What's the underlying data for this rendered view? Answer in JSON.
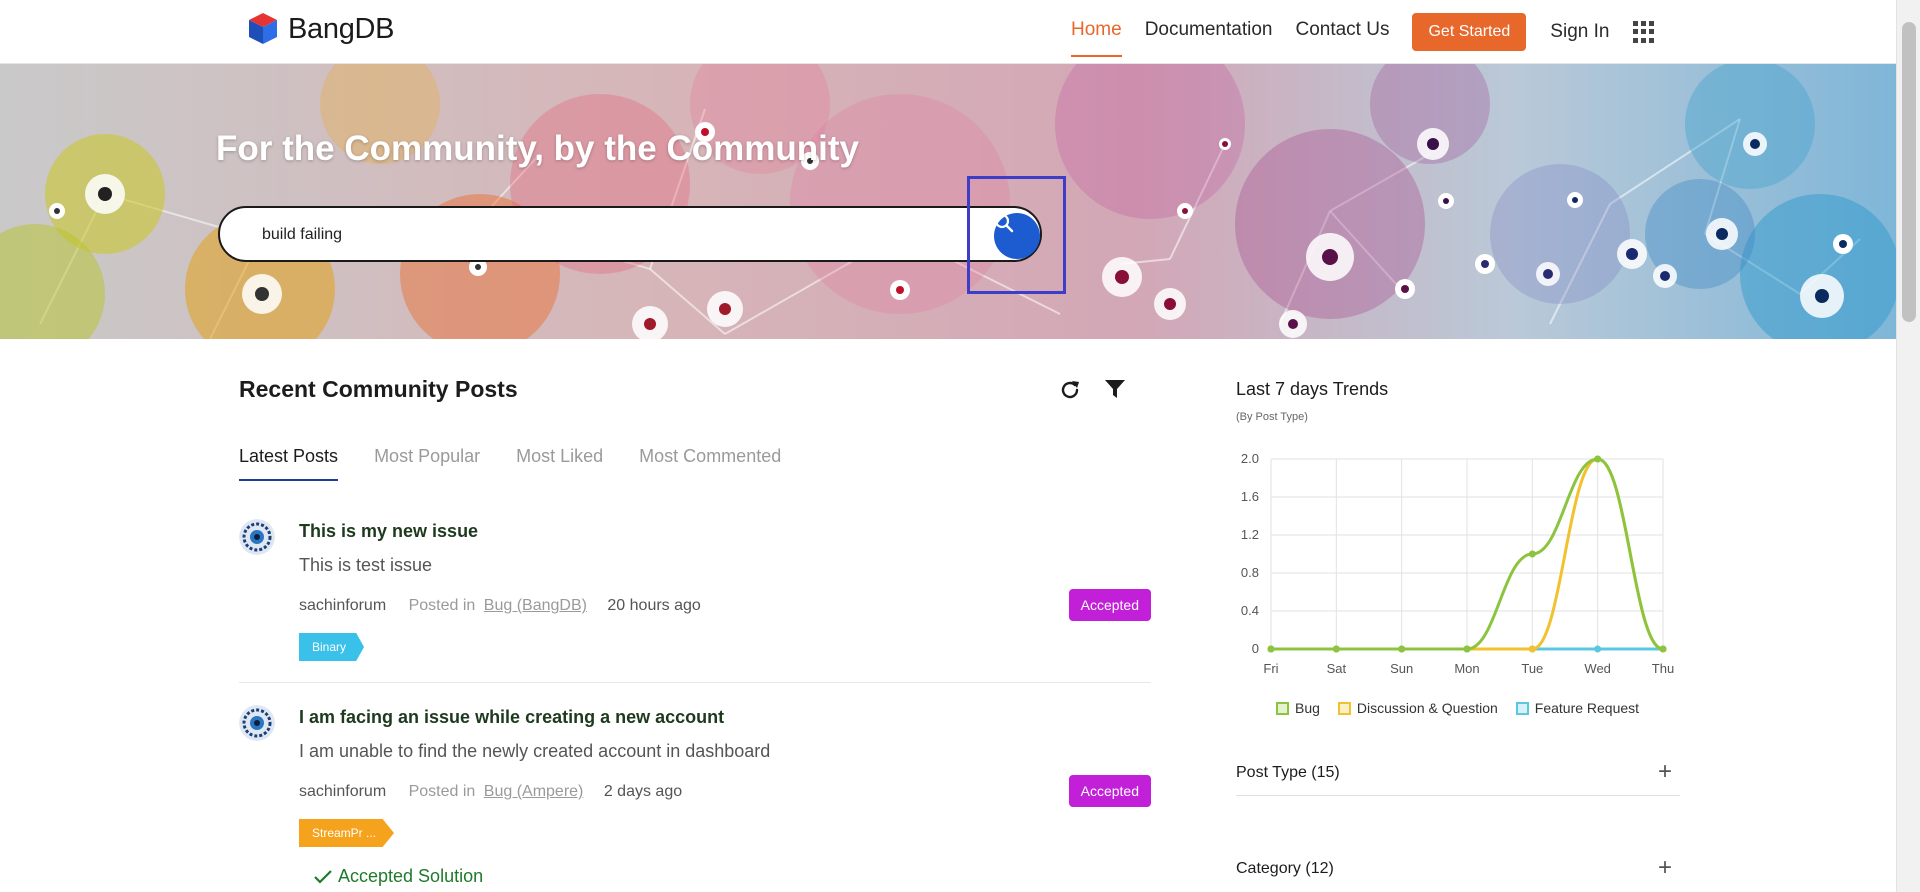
{
  "header": {
    "brand": "BangDB",
    "nav": [
      "Home",
      "Documentation",
      "Contact Us"
    ],
    "cta": "Get Started",
    "sign_in": "Sign In"
  },
  "hero": {
    "title": "For the Community, by the Community",
    "search_value": "build failing"
  },
  "posts_section": {
    "title": "Recent Community Posts",
    "tabs": [
      "Latest Posts",
      "Most Popular",
      "Most Liked",
      "Most Commented"
    ],
    "active_tab": "Latest Posts",
    "posted_in_label": "Posted in",
    "posts": [
      {
        "title": "This is my new issue",
        "body": "This is test issue",
        "author": "sachinforum",
        "category": "Bug (BangDB)",
        "time": "20 hours ago",
        "status": "Accepted",
        "tag": "Binary"
      },
      {
        "title": "I am facing an issue while creating a new account",
        "body": "I am unable to find the newly created account in dashboard",
        "author": "sachinforum",
        "category": "Bug (Ampere)",
        "time": "2 days ago",
        "status": "Accepted",
        "tag": "StreamPr ...",
        "accepted_solution": "Accepted Solution"
      }
    ]
  },
  "trends": {
    "title": "Last 7 days Trends",
    "subtitle": "(By Post Type)",
    "accordions": [
      "Post Type (15)",
      "Category (12)"
    ]
  },
  "colors": {
    "brand_orange": "#e8672b",
    "accepted_badge": "#c21fd9",
    "search_button": "#1d5bd1",
    "bug": "#8cc43f",
    "discussion": "#f0c22e",
    "feature": "#5ac8e0"
  },
  "chart_data": {
    "type": "line",
    "title": "Last 7 days Trends",
    "subtitle": "(By Post Type)",
    "categories": [
      "Fri",
      "Sat",
      "Sun",
      "Mon",
      "Tue",
      "Wed",
      "Thu"
    ],
    "ylim": [
      0,
      2.0
    ],
    "yticks": [
      "0",
      "0.4",
      "0.8",
      "1.2",
      "1.6",
      "2.0"
    ],
    "grid": true,
    "legend": "bottom",
    "series": [
      {
        "name": "Bug",
        "values": [
          0,
          0,
          0,
          0,
          1,
          2,
          0
        ],
        "color": "#8cc43f"
      },
      {
        "name": "Discussion & Question",
        "values": [
          0,
          0,
          0,
          0,
          0,
          2,
          0
        ],
        "color": "#f0c22e"
      },
      {
        "name": "Feature Request",
        "values": [
          0,
          0,
          0,
          0,
          0,
          0,
          0
        ],
        "color": "#5ac8e0"
      }
    ]
  }
}
